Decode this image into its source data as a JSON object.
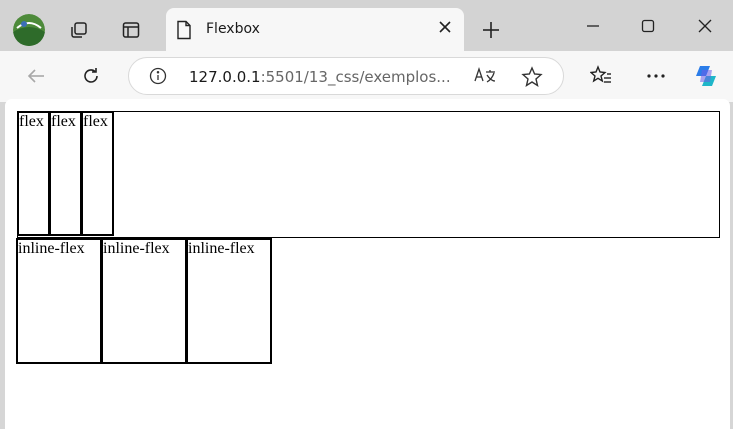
{
  "tab": {
    "title": "Flexbox"
  },
  "address_bar": {
    "url_host": "127.0.0.1",
    "url_path": ":5501/13_css/exemplos..."
  },
  "flex_container": {
    "items": [
      "flex",
      "flex",
      "flex"
    ]
  },
  "inline_flex_container": {
    "items": [
      "inline-flex",
      "inline-flex",
      "inline-flex"
    ]
  },
  "colors": {
    "tabstrip": "#d3d3d3",
    "toolbar": "#f7f7f7",
    "page": "#ffffff"
  }
}
